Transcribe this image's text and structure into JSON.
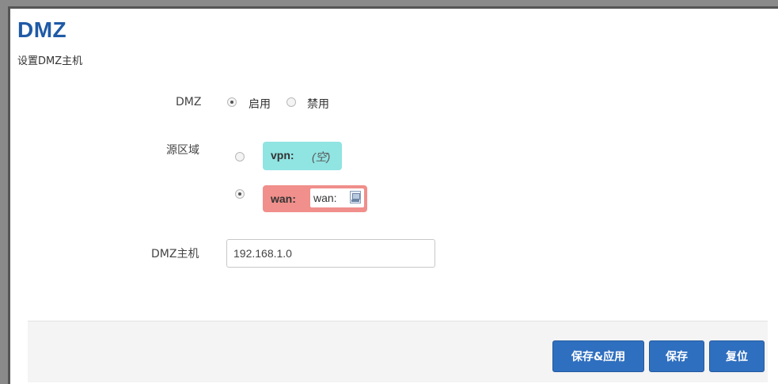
{
  "page": {
    "title": "DMZ",
    "subtitle": "设置DMZ主机"
  },
  "dmz": {
    "label": "DMZ",
    "options": [
      {
        "label": "启用",
        "checked": true
      },
      {
        "label": "禁用",
        "checked": false
      }
    ]
  },
  "source_zone": {
    "label": "源区域",
    "zones": [
      {
        "name": "vpn:",
        "networks": "(空)",
        "checked": false,
        "color": "#90e4e2"
      },
      {
        "name": "wan:",
        "networks": "wan:",
        "checked": true,
        "color": "#f08f8b"
      }
    ]
  },
  "dmz_host": {
    "label": "DMZ主机",
    "value": "192.168.1.0"
  },
  "buttons": {
    "save_apply": "保存&应用",
    "save": "保存",
    "reset": "复位"
  }
}
